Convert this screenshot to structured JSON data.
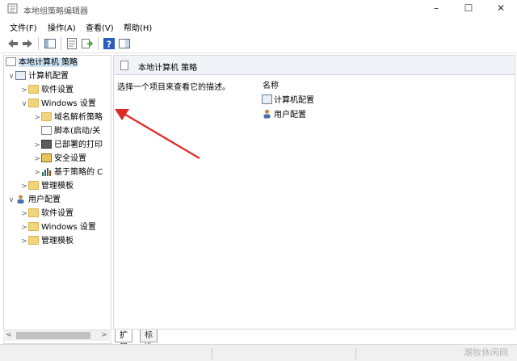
{
  "window": {
    "title": "本地组策略编辑器",
    "controls": [
      "–",
      "☐",
      "✕"
    ]
  },
  "menu": [
    "文件(F)",
    "操作(A)",
    "查看(V)",
    "帮助(H)"
  ],
  "tree": [
    {
      "label": "本地计算机 策略",
      "icon": "policy-doc-icon",
      "selected": true
    },
    {
      "label": "计算机配置",
      "icon": "computer-icon",
      "chevron": "∨"
    },
    {
      "label": "软件设置",
      "icon": "folder-icon",
      "chevron": ">"
    },
    {
      "label": "Windows 设置",
      "icon": "folder-icon",
      "chevron": "∨"
    },
    {
      "label": "域名解析策略",
      "icon": "folder-icon",
      "chevron": ">"
    },
    {
      "label": "脚本(启动/关",
      "icon": "script-icon",
      "chevron": ""
    },
    {
      "label": "已部署的打印",
      "icon": "printer-icon",
      "chevron": ">"
    },
    {
      "label": "安全设置",
      "icon": "security-icon",
      "chevron": ">"
    },
    {
      "label": "基于策略的 C",
      "icon": "chart-icon",
      "chevron": ">"
    },
    {
      "label": "管理模板",
      "icon": "folder-icon",
      "chevron": ">"
    },
    {
      "label": "用户配置",
      "icon": "user-icon",
      "chevron": "∨"
    },
    {
      "label": "软件设置",
      "icon": "folder-icon",
      "chevron": ">"
    },
    {
      "label": "Windows 设置",
      "icon": "folder-icon",
      "chevron": ">"
    },
    {
      "label": "管理模板",
      "icon": "folder-icon",
      "chevron": ">"
    }
  ],
  "right": {
    "header_title": "本地计算机 策略",
    "description": "选择一个项目来查看它的描述。",
    "column_name": "名称",
    "items": [
      "计算机配置",
      "用户配置"
    ]
  },
  "tabs": [
    "扩展",
    "标准"
  ],
  "watermark": "潮牧休闲网",
  "colors": {
    "annotation_arrow": "#e02a2a",
    "selection": "#cce4f7",
    "header_bg": "#f1f3f8"
  }
}
